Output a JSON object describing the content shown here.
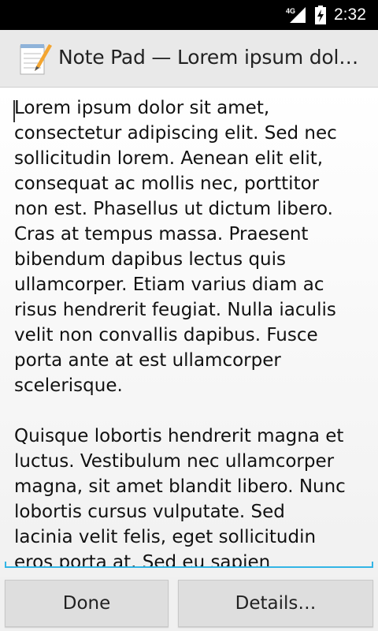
{
  "status_bar": {
    "network": "4G",
    "time": "2:32"
  },
  "action_bar": {
    "title": "Note Pad — Lorem ipsum dolor…",
    "icon": "notepad-icon"
  },
  "editor": {
    "paragraphs": [
      "Lorem ipsum dolor sit amet,\nconsectetur adipiscing elit. Sed nec\nsollicitudin lorem. Aenean elit elit,\nconsequat ac mollis nec, porttitor\nnon est. Phasellus ut dictum libero.\nCras at tempus massa. Praesent\nbibendum dapibus lectus quis\nullamcorper. Etiam varius diam ac\nrisus hendrerit feugiat. Nulla iaculis\nvelit non convallis dapibus. Fusce\nporta ante at est ullamcorper\nscelerisque.",
      "Quisque lobortis hendrerit magna et\nluctus. Vestibulum nec ullamcorper\nmagna, sit amet blandit libero. Nunc\nlobortis cursus vulputate. Sed\nlacinia velit felis, eget sollicitudin\neros porta at. Sed eu sapien"
    ]
  },
  "buttons": {
    "done": "Done",
    "details": "Details…"
  },
  "colors": {
    "accent": "#33b5e5",
    "action_bar_bg": "#e9e9e9",
    "button_bg": "#dedede"
  }
}
